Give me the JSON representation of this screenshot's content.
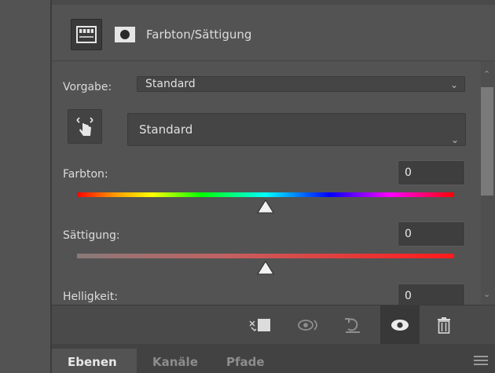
{
  "header": {
    "title": "Farbton/Sättigung"
  },
  "preset": {
    "label": "Vorgabe:",
    "value": "Standard"
  },
  "channel": {
    "value": "Standard"
  },
  "sliders": [
    {
      "label": "Farbton:",
      "value": "0",
      "thumb_position": 0.5
    },
    {
      "label": "Sättigung:",
      "value": "0",
      "thumb_position": 0.5
    },
    {
      "label": "Helligkeit:",
      "value": "0",
      "thumb_position": 0.5
    }
  ],
  "toolbar_icons": [
    "clip-to-layer-icon",
    "view-previous-state-icon",
    "reset-icon",
    "visibility-eye-icon",
    "trash-icon"
  ],
  "tabs": [
    {
      "label": "Ebenen",
      "active": true
    },
    {
      "label": "Kanäle",
      "active": false
    },
    {
      "label": "Pfade",
      "active": false
    }
  ],
  "colors": {
    "panel_bg": "#535353",
    "input_bg": "#454545",
    "toolbar_bg": "#4a4a4a",
    "text": "#dcdcdc"
  }
}
